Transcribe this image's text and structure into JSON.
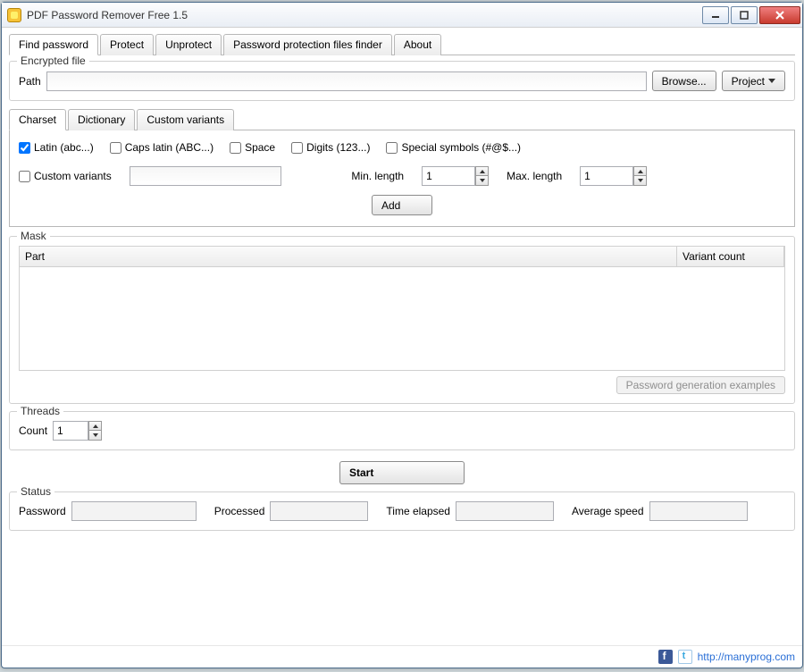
{
  "window": {
    "title": "PDF Password Remover Free 1.5"
  },
  "mainTabs": [
    {
      "label": "Find password",
      "active": true
    },
    {
      "label": "Protect"
    },
    {
      "label": "Unprotect"
    },
    {
      "label": "Password protection files finder"
    },
    {
      "label": "About"
    }
  ],
  "encrypted": {
    "legend": "Encrypted file",
    "pathLabel": "Path",
    "pathValue": "",
    "browse": "Browse...",
    "project": "Project"
  },
  "charsetTabs": [
    {
      "label": "Charset",
      "active": true
    },
    {
      "label": "Dictionary"
    },
    {
      "label": "Custom variants"
    }
  ],
  "charset": {
    "latin": "Latin (abc...)",
    "caps": "Caps latin (ABC...)",
    "space": "Space",
    "digits": "Digits (123...)",
    "special": "Special symbols (#@$...)",
    "customVariants": "Custom variants",
    "customValue": "",
    "minLenLabel": "Min. length",
    "minLen": "1",
    "maxLenLabel": "Max. length",
    "maxLen": "1",
    "add": "Add"
  },
  "mask": {
    "legend": "Mask",
    "colPart": "Part",
    "colVariant": "Variant count",
    "examplesBtn": "Password generation examples"
  },
  "threads": {
    "legend": "Threads",
    "countLabel": "Count",
    "count": "1"
  },
  "start": "Start",
  "status": {
    "legend": "Status",
    "passwordLabel": "Password",
    "passwordValue": "",
    "processedLabel": "Processed",
    "processedValue": "",
    "timeLabel": "Time elapsed",
    "timeValue": "",
    "speedLabel": "Average speed",
    "speedValue": ""
  },
  "footer": {
    "url": "http://manyprog.com"
  }
}
